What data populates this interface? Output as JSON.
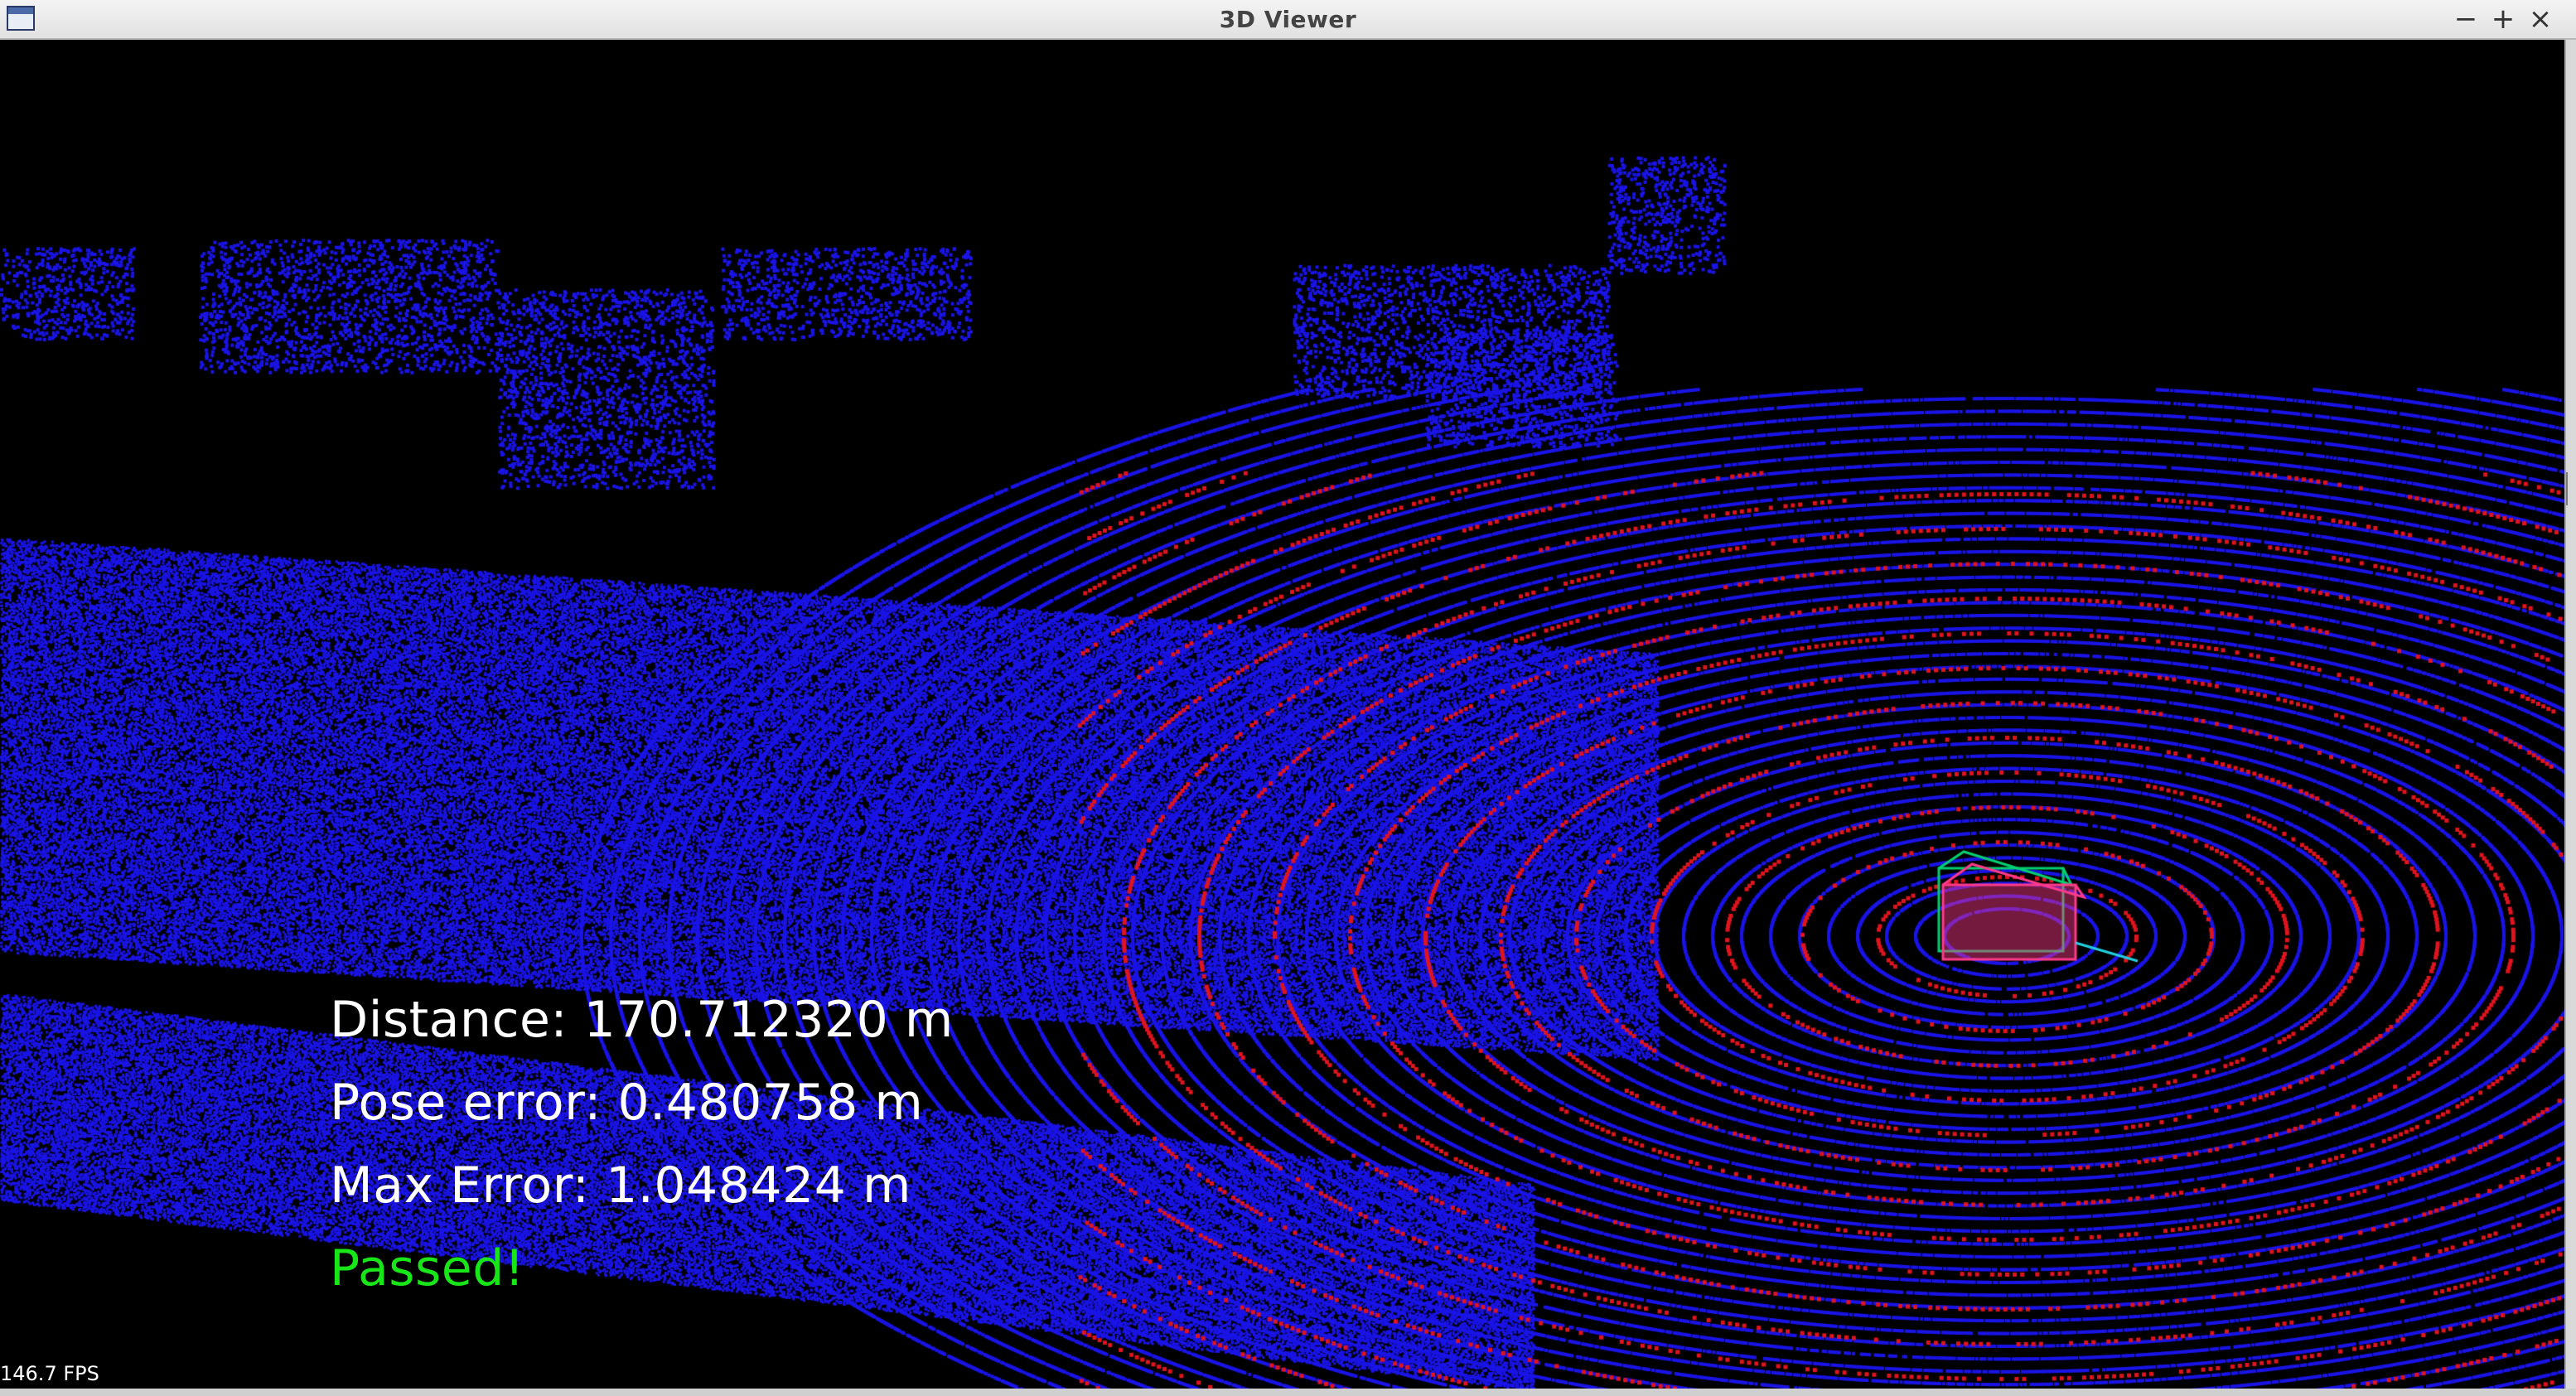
{
  "window": {
    "title": "3D Viewer",
    "minimize_label": "−",
    "maximize_label": "+",
    "close_label": "×",
    "app_icon": "window-icon"
  },
  "viewer": {
    "background": "#000000",
    "point_colors": {
      "map_points": "#1a14e6",
      "scan_points": "#e0141e"
    },
    "box_colors": {
      "ground_truth": "#00d070",
      "estimate": "#ff3a8a",
      "axis": "#20d0e0"
    }
  },
  "overlay": {
    "distance": "Distance: 170.712320 m",
    "pose_error": "Pose error: 0.480758 m",
    "max_error": "Max Error: 1.048424 m",
    "status": "Passed!",
    "status_color": "#19e619"
  },
  "fps": "146.7 FPS"
}
